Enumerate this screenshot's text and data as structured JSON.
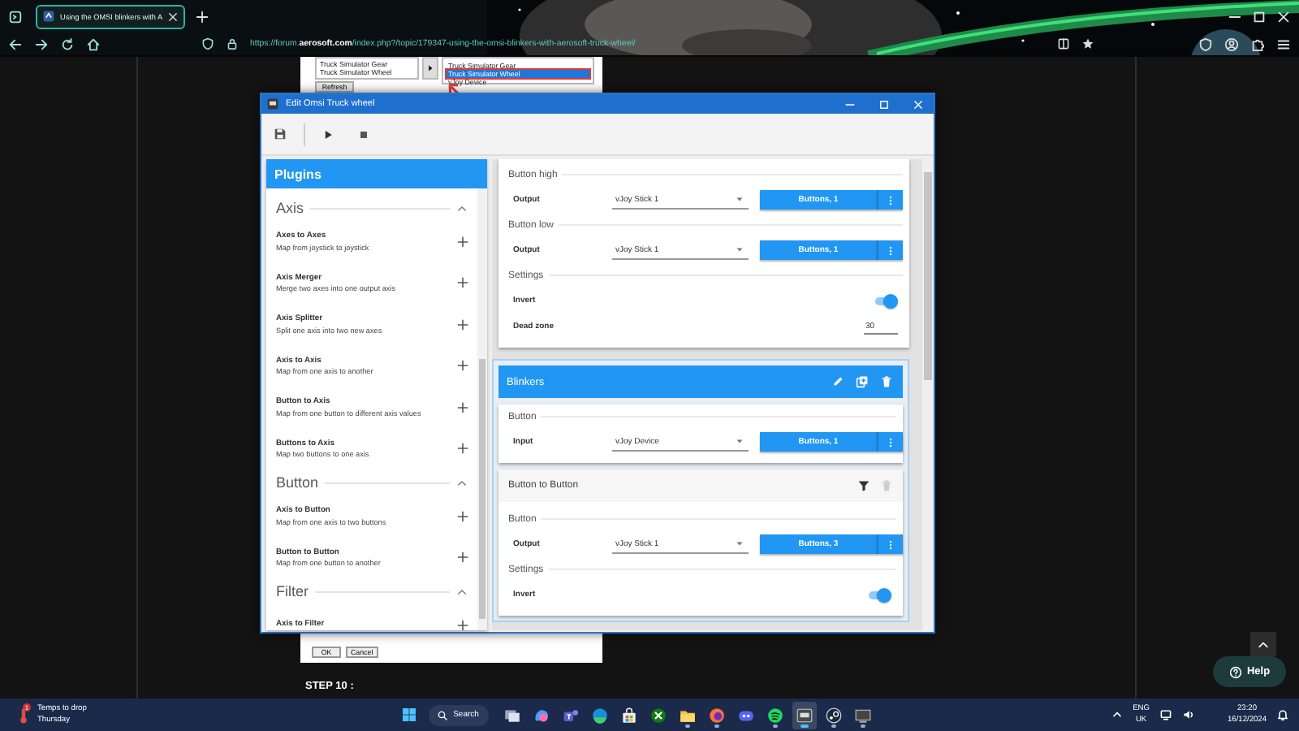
{
  "browser": {
    "tab": {
      "title": "Using the OMSI blinkers with A",
      "selected": true
    },
    "url": "https://forum.**aerosoft.com**/index.php?/topic/179347-using-the-omsi-blinkers-with-aerosoft-truck-wheel/"
  },
  "article": {
    "screenshot": {
      "left_list": [
        "Truck Simulator Gear",
        "Truck Simulator Wheel"
      ],
      "right_list": [
        {
          "label": "Truck Simulator Gear",
          "selected": false
        },
        {
          "label": "Truck Simulator Wheel",
          "selected": true
        },
        {
          "label": "vJoy Device",
          "selected": false
        }
      ],
      "refresh_button": "Refresh",
      "ok_button": "OK",
      "cancel_button": "Cancel"
    },
    "heading": "STEP 10 :"
  },
  "help_button": "Help",
  "dialog": {
    "title": "Edit Omsi Truck wheel",
    "plugins": {
      "title": "Plugins",
      "groups": [
        {
          "name": "Axis",
          "expanded": true,
          "items": [
            {
              "title": "Axes to Axes",
              "description": "Map from joystick to joystick"
            },
            {
              "title": "Axis Merger",
              "description": "Merge two axes into one output axis"
            },
            {
              "title": "Axis Splitter",
              "description": "Split one axis into two new axes"
            },
            {
              "title": "Axis to Axis",
              "description": "Map from one axis to another"
            },
            {
              "title": "Button to Axis",
              "description": "Map from one button to different axis values"
            },
            {
              "title": "Buttons to Axis",
              "description": "Map two buttons to one axis"
            }
          ]
        },
        {
          "name": "Button",
          "expanded": true,
          "items": [
            {
              "title": "Axis to Button",
              "description": "Map from one axis to two buttons"
            },
            {
              "title": "Button to Button",
              "description": "Map from one button to another"
            }
          ]
        },
        {
          "name": "Filter",
          "expanded": true,
          "items": [
            {
              "title": "Axis to Filter"
            }
          ]
        }
      ]
    },
    "mappings": [
      {
        "kind": "card",
        "sections": [
          {
            "title": "Button high",
            "rows": [
              {
                "kind": "device",
                "label": "Output",
                "device": "vJoy Stick 1",
                "button": "Buttons, 1"
              }
            ]
          },
          {
            "title": "Button low",
            "rows": [
              {
                "kind": "device",
                "label": "Output",
                "device": "vJoy Stick 1",
                "button": "Buttons, 1"
              }
            ]
          },
          {
            "title": "Settings",
            "rows": [
              {
                "kind": "toggle",
                "label": "Invert",
                "on": true
              },
              {
                "kind": "number",
                "label": "Dead zone",
                "value": "30"
              }
            ]
          }
        ]
      },
      {
        "kind": "group",
        "title": "Blinkers",
        "cards": [
          {
            "sections": [
              {
                "title": "Button",
                "rows": [
                  {
                    "kind": "device",
                    "label": "Input",
                    "device": "vJoy Device",
                    "button": "Buttons, 1"
                  }
                ]
              }
            ]
          },
          {
            "title": "Button to Button",
            "delete_disabled": true,
            "sections": [
              {
                "title": "Button",
                "rows": [
                  {
                    "kind": "device",
                    "label": "Output",
                    "device": "vJoy Stick 1",
                    "button": "Buttons, 3"
                  }
                ]
              },
              {
                "title": "Settings",
                "rows": [
                  {
                    "kind": "toggle",
                    "label": "Invert",
                    "on": true
                  }
                ]
              }
            ]
          }
        ]
      }
    ]
  },
  "taskbar": {
    "weather": {
      "badge": "1",
      "title": "Temps to drop",
      "subtitle": "Thursday"
    },
    "search": "Search",
    "apps": [
      {
        "running": false,
        "selected": false
      },
      {
        "running": false,
        "selected": false
      },
      {
        "running": false,
        "selected": false
      },
      {
        "running": false,
        "selected": false
      },
      {
        "running": false,
        "selected": false
      },
      {
        "running": false,
        "selected": false
      },
      {
        "running": true,
        "selected": false
      },
      {
        "running": true,
        "selected": false
      },
      {
        "running": false,
        "selected": false
      },
      {
        "running": true,
        "selected": false
      },
      {
        "running": true,
        "selected": true
      },
      {
        "running": true,
        "selected": false
      },
      {
        "running": true,
        "selected": false
      }
    ],
    "language": "ENG",
    "region": "UK",
    "time": "23:20",
    "date": "16/12/2024"
  }
}
